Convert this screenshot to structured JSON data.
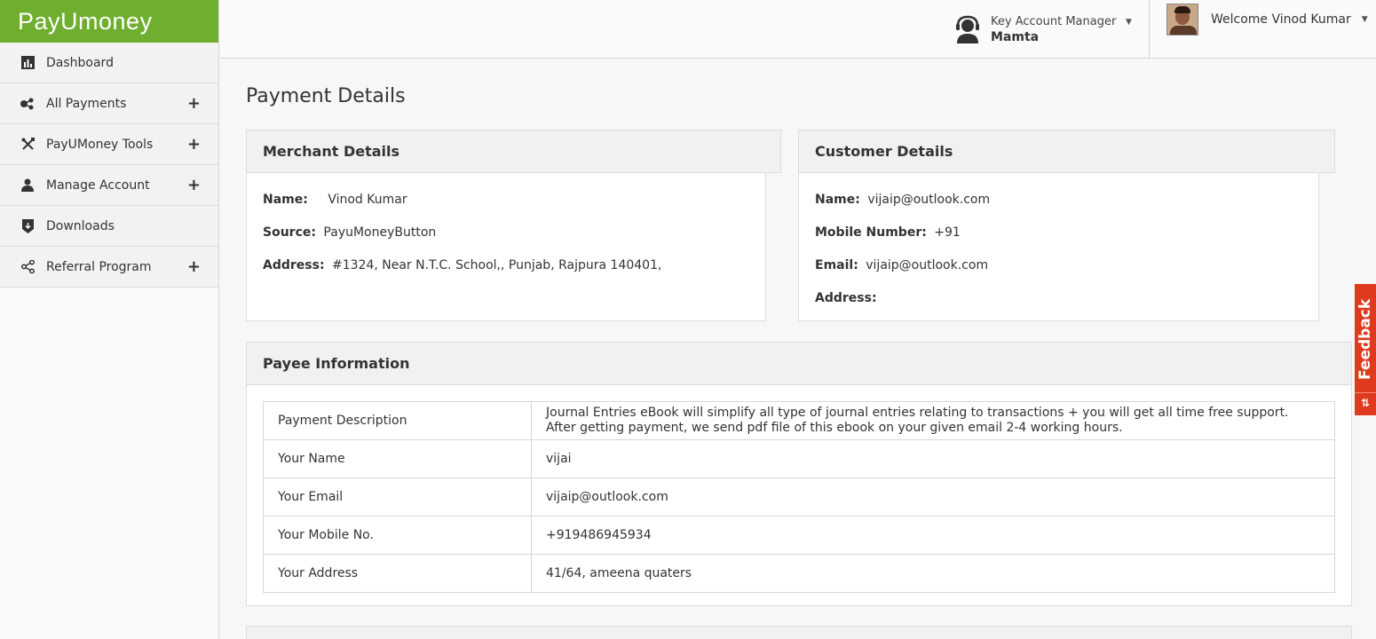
{
  "brand": {
    "logo_text": "PayUmoney"
  },
  "sidebar": {
    "items": [
      {
        "label": "Dashboard",
        "icon": "bar-chart-icon",
        "expand": ""
      },
      {
        "label": "All Payments",
        "icon": "payments-icon",
        "expand": "+"
      },
      {
        "label": "PayUMoney Tools",
        "icon": "tools-icon",
        "expand": "+"
      },
      {
        "label": "Manage Account",
        "icon": "user-icon",
        "expand": "+"
      },
      {
        "label": "Downloads",
        "icon": "download-icon",
        "expand": ""
      },
      {
        "label": "Referral Program",
        "icon": "share-icon",
        "expand": "+"
      }
    ]
  },
  "header": {
    "kam_label": "Key Account Manager",
    "kam_name": "Mamta",
    "welcome": "Welcome Vinod Kumar"
  },
  "page_title": "Payment Details",
  "merchant": {
    "title": "Merchant Details",
    "name_label": "Name:",
    "name": "Vinod Kumar",
    "source_label": "Source:",
    "source": "PayuMoneyButton",
    "address_label": "Address:",
    "address": "#1324, Near N.T.C. School,, Punjab, Rajpura 140401,"
  },
  "customer": {
    "title": "Customer Details",
    "name_label": "Name:",
    "name": "vijaip@outlook.com",
    "mobile_label": "Mobile Number:",
    "mobile": "+91",
    "email_label": "Email:",
    "email": "vijaip@outlook.com",
    "address_label": "Address:",
    "address": ""
  },
  "payee": {
    "title": "Payee Information",
    "rows": [
      {
        "key": "Payment Description",
        "value": "Journal Entries eBook will simplify all type of journal entries relating to transactions + you will get all time free support. After getting payment, we send pdf file of this ebook on your given email 2-4 working hours."
      },
      {
        "key": "Your Name",
        "value": "vijai"
      },
      {
        "key": "Your Email",
        "value": "vijaip@outlook.com"
      },
      {
        "key": "Your Mobile No.",
        "value": "+919486945934"
      },
      {
        "key": "Your Address",
        "value": "41/64, ameena quaters"
      }
    ]
  },
  "feedback": {
    "label": "Feedback",
    "arrows": "⇅"
  },
  "colors": {
    "brand_green": "#6fae2e",
    "feedback_red": "#e03a1e"
  }
}
